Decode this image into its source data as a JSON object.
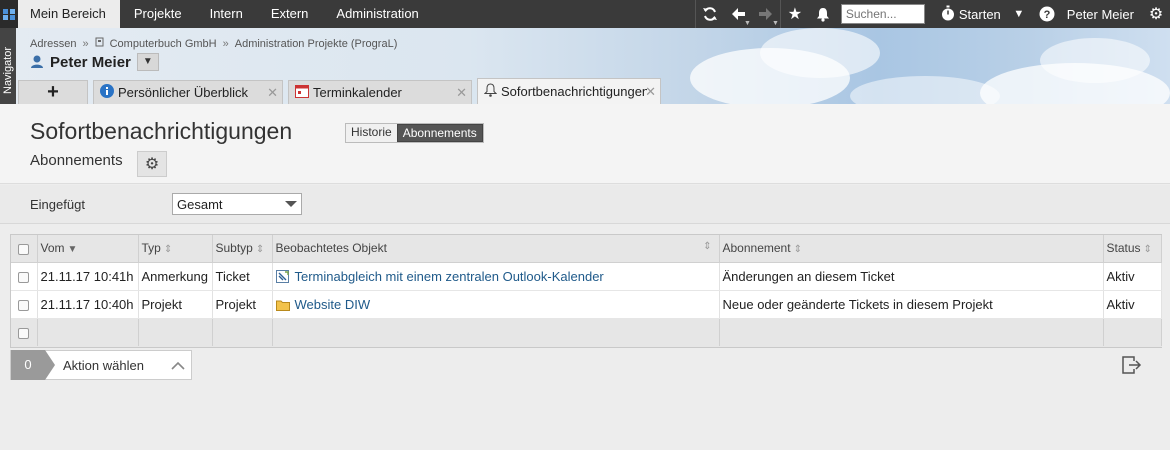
{
  "topnav": {
    "menu": [
      "Mein Bereich",
      "Projekte",
      "Intern",
      "Extern",
      "Administration"
    ],
    "search_placeholder": "Suchen...",
    "start_label": "Starten",
    "user": "Peter Meier"
  },
  "navigator_label": "Navigator",
  "breadcrumb": [
    "Adressen",
    "Computerbuch GmbH",
    "Administration Projekte (PrograL)"
  ],
  "person_name": "Peter Meier",
  "tabs": [
    {
      "label": "Persönlicher Überblick"
    },
    {
      "label": "Terminkalender"
    },
    {
      "label": "Sofortbenachrichtigungen"
    }
  ],
  "page": {
    "title": "Sofortbenachrichtigungen",
    "segments": [
      "Historie",
      "Abonnements"
    ],
    "active_segment": "Abonnements",
    "subtitle": "Abonnements"
  },
  "filter": {
    "label": "Eingefügt",
    "value": "Gesamt"
  },
  "table": {
    "columns": [
      "Vom",
      "Typ",
      "Subtyp",
      "Beobachtetes Objekt",
      "Abonnement",
      "Status"
    ],
    "rows": [
      {
        "vom": "21.11.17 10:41h",
        "typ": "Anmerkung",
        "subtyp": "Ticket",
        "objekt": "Terminabgleich mit einem zentralen Outlook-Kalender",
        "objekt_icon": "ticket-icon",
        "abonnement": "Änderungen an diesem Ticket",
        "status": "Aktiv"
      },
      {
        "vom": "21.11.17 10:40h",
        "typ": "Projekt",
        "subtyp": "Projekt",
        "objekt": "Website DIW",
        "objekt_icon": "folder-icon",
        "abonnement": "Neue oder geänderte Tickets in diesem Projekt",
        "status": "Aktiv"
      }
    ]
  },
  "action_bar": {
    "count": "0",
    "label": "Aktion wählen"
  },
  "colors": {
    "topbar": "#3a3a3a",
    "link": "#1f5a8a",
    "accent": "#4a90d9"
  }
}
